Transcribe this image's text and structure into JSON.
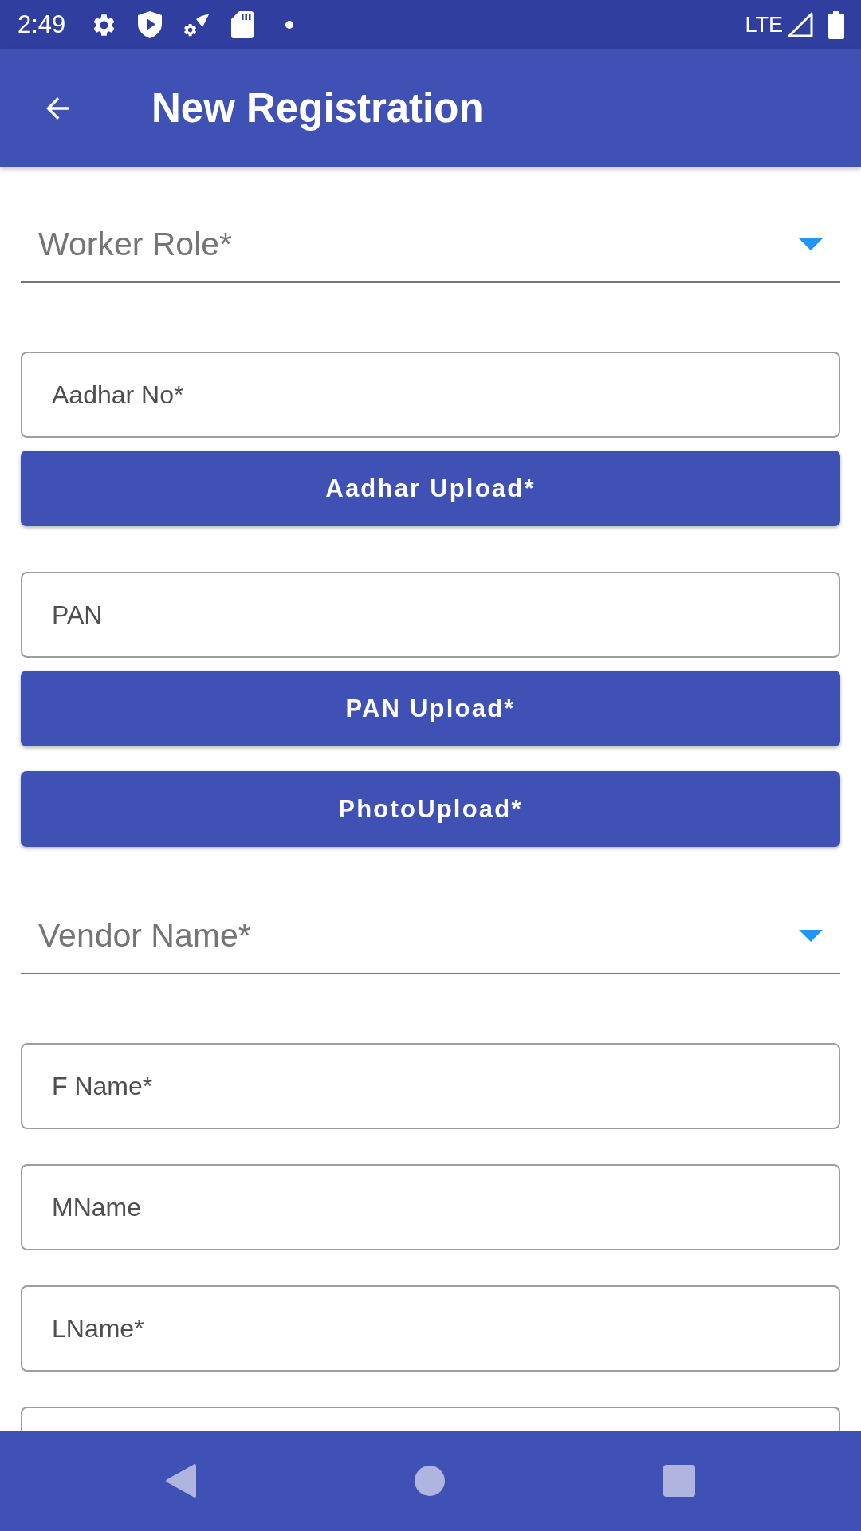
{
  "status_bar": {
    "time": "2:49",
    "network": "LTE"
  },
  "app_bar": {
    "title": "New Registration"
  },
  "form": [
    {
      "kind": "dropdown",
      "label": "Worker Role*"
    },
    {
      "kind": "text_field",
      "placeholder": "Aadhar No*"
    },
    {
      "kind": "button",
      "label": "Aadhar Upload*"
    },
    {
      "kind": "text_field",
      "placeholder": "PAN"
    },
    {
      "kind": "button",
      "label": "PAN Upload*"
    },
    {
      "kind": "button",
      "label": "PhotoUpload*"
    },
    {
      "kind": "dropdown",
      "label": "Vendor Name*"
    },
    {
      "kind": "text_field",
      "placeholder": "F Name*"
    },
    {
      "kind": "text_field",
      "placeholder": "MName"
    },
    {
      "kind": "text_field",
      "placeholder": "LName*"
    },
    {
      "kind": "text_field"
    }
  ]
}
